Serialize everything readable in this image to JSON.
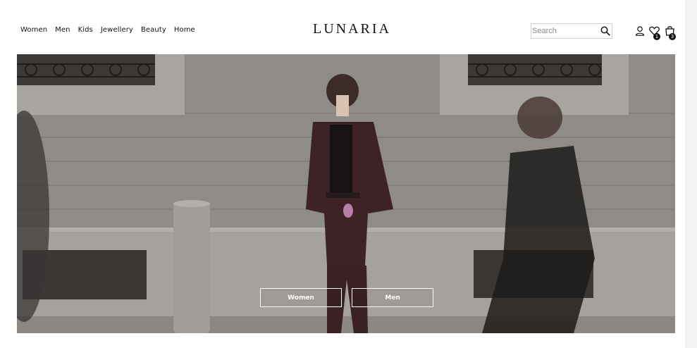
{
  "nav": {
    "items": [
      "Women",
      "Men",
      "Kids",
      "Jewellery",
      "Beauty",
      "Home"
    ]
  },
  "brand": {
    "name": "LUNARIA"
  },
  "search": {
    "placeholder": "Search"
  },
  "icons": {
    "account": "user-icon",
    "wishlist": "heart-icon",
    "bag": "shopping-bag-icon",
    "search": "search-icon"
  },
  "wishlist": {
    "count": "1"
  },
  "bag": {
    "count": "3"
  },
  "hero": {
    "image": "Street fashion photo: model in burgundy denim jacket and trousers standing against stone building, blurred pedestrian passing on right",
    "buttons": {
      "women": "Women",
      "men": "Men"
    }
  }
}
